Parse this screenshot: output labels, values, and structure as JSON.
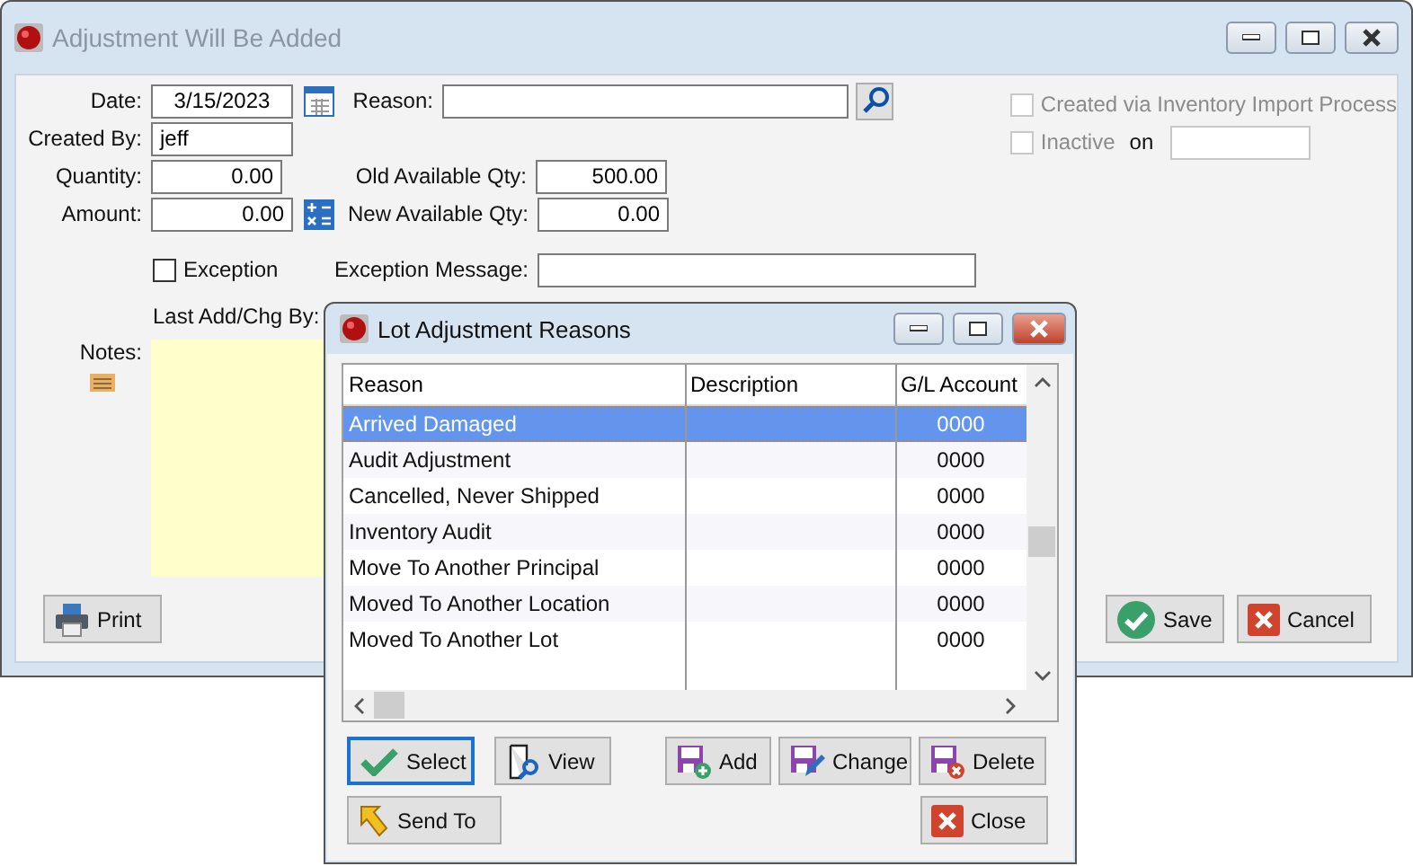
{
  "main_window": {
    "title": "Adjustment Will Be Added",
    "date": {
      "label": "Date:",
      "value": "3/15/2023"
    },
    "reason": {
      "label": "Reason:"
    },
    "created_by": {
      "label": "Created By:",
      "value": "jeff"
    },
    "quantity": {
      "label": "Quantity:",
      "value": "0.00"
    },
    "amount": {
      "label": "Amount:",
      "value": "0.00"
    },
    "old_available_qty": {
      "label": "Old Available Qty:",
      "value": "500.00"
    },
    "new_available_qty": {
      "label": "New Available Qty:",
      "value": "0.00"
    },
    "exception": {
      "label": "Exception",
      "checked": false
    },
    "exception_message": {
      "label": "Exception Message:"
    },
    "last_add_chg_by": {
      "label": "Last Add/Chg By:"
    },
    "notes": {
      "label": "Notes:"
    },
    "created_via_import": {
      "label": "Created via Inventory Import Process",
      "checked": false,
      "disabled": true
    },
    "inactive": {
      "label": "Inactive",
      "checked": false,
      "disabled": true,
      "on_label": "on"
    },
    "buttons": [
      {
        "label": "Print",
        "kind": "print"
      },
      {
        "label": "Save",
        "kind": "save"
      },
      {
        "label": "Cancel",
        "kind": "cancel"
      }
    ]
  },
  "dialog": {
    "title": "Lot Adjustment Reasons",
    "columns": [
      "Reason",
      "Description",
      "G/L Account"
    ],
    "rows": [
      {
        "reason": "Arrived Damaged",
        "gl_account": "0000",
        "selected": true
      },
      {
        "reason": "Audit Adjustment",
        "gl_account": "0000",
        "selected": false
      },
      {
        "reason": "Cancelled, Never Shipped",
        "gl_account": "0000",
        "selected": false
      },
      {
        "reason": "Inventory Audit",
        "gl_account": "0000",
        "selected": false
      },
      {
        "reason": "Move To Another Principal",
        "gl_account": "0000",
        "selected": false
      },
      {
        "reason": "Moved To Another Location",
        "gl_account": "0000",
        "selected": false
      },
      {
        "reason": "Moved To Another Lot",
        "gl_account": "0000",
        "selected": false
      }
    ],
    "buttons": [
      {
        "label": "Select",
        "kind": "select",
        "focused": true
      },
      {
        "label": "View",
        "kind": "view",
        "focused": false
      },
      {
        "label": "Add",
        "kind": "add",
        "focused": false
      },
      {
        "label": "Change",
        "kind": "change",
        "focused": false
      },
      {
        "label": "Delete",
        "kind": "delete",
        "focused": false
      },
      {
        "label": "Send To",
        "kind": "send",
        "focused": false
      },
      {
        "label": "Close",
        "kind": "close",
        "focused": false
      }
    ]
  }
}
